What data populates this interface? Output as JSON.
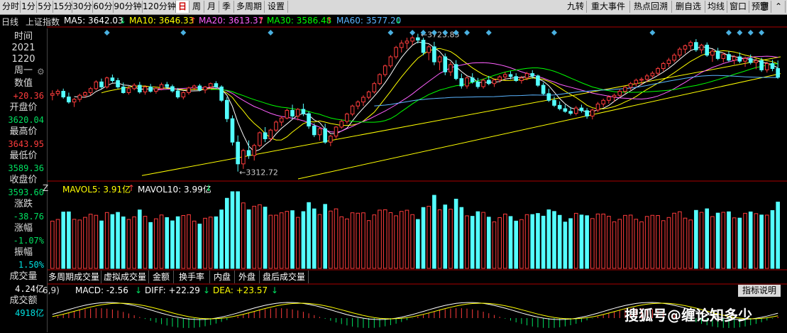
{
  "toolbar": {
    "left": [
      "分时",
      "1分",
      "5分",
      "15分",
      "30分",
      "60分",
      "90分钟",
      "120分钟",
      "日",
      "周",
      "月",
      "季",
      "多周期",
      "设置"
    ],
    "active_index": 8,
    "right": [
      "九转",
      "重大事件",
      "热点回溯",
      "删自选",
      "均线",
      "窗口",
      "预测"
    ]
  },
  "ma_legend": {
    "period": "日线",
    "name": "上证指数",
    "ma5": "MA5: 3642.03",
    "ma5_dir": "↓",
    "ma10": "MA10: 3646.33",
    "ma10_dir": "↑",
    "ma20": "MA20: 3613.37",
    "ma20_dir": "↑",
    "ma30": "MA30: 3586.48",
    "ma30_dir": "↑",
    "ma60": "MA60: 3577.20",
    "ma60_dir": "↓"
  },
  "left_panel": {
    "time_label": "时间",
    "year": "2021",
    "date": "1220",
    "weekday": "周一",
    "value_label": "数值",
    "value": "+20.36",
    "open_label": "开盘价",
    "open": "3620.04",
    "high_label": "最高价",
    "high": "3643.95",
    "low_label": "最低价",
    "low": "3589.36",
    "close_label": "收盘价",
    "close": "3593.60",
    "change_label": "涨跌",
    "change": "-38.76",
    "pct_label": "涨幅",
    "pct": "-1.07%",
    "amp_label": "振幅",
    "amp": "1.50%",
    "vol_label": "成交量",
    "vol": "4.24亿",
    "amt_label": "成交额",
    "amt": "4918亿"
  },
  "price_annotations": {
    "high": "3723.85",
    "low": "3312.72"
  },
  "vol_legend": {
    "cut": "Z",
    "mavol5": "MAVOL5: 3.91亿",
    "mavol5_dir": "↑",
    "mavol10": "MAVOL10: 3.99亿",
    "mavol10_dir": "↓"
  },
  "indicator_tabs": [
    "多周期成交量",
    "虚拟成交量",
    "金额",
    "换手率",
    "内盘",
    "外盘",
    "盘后成交量"
  ],
  "macd_legend": {
    "params": "6,9)",
    "macd": "MACD: -2.56",
    "macd_dir": "↓",
    "diff": "DIFF: +22.29",
    "diff_dir": "↓",
    "dea": "DEA: +23.57",
    "dea_dir": "↓"
  },
  "help_button": "指标说明",
  "watermark": "搜狐号@缠论知多少",
  "colors": {
    "up": "#ff3c3c",
    "down": "#54ffff",
    "ma5": "#ffffff",
    "ma10": "#ffff00",
    "ma20": "#ff60ff",
    "ma30": "#00ff00",
    "ma60": "#5ab4ff",
    "toolbar_bg": "#d9d9d9"
  },
  "chart_data": {
    "type": "candlestick",
    "title": "上证指数 日线",
    "ylim": [
      3290,
      3740
    ],
    "candles": [
      [
        3540,
        3555,
        3525,
        3545
      ],
      [
        3545,
        3558,
        3538,
        3552
      ],
      [
        3552,
        3560,
        3530,
        3535
      ],
      [
        3535,
        3548,
        3515,
        3520
      ],
      [
        3520,
        3532,
        3505,
        3528
      ],
      [
        3528,
        3545,
        3520,
        3540
      ],
      [
        3540,
        3552,
        3532,
        3548
      ],
      [
        3548,
        3565,
        3540,
        3560
      ],
      [
        3560,
        3585,
        3555,
        3580
      ],
      [
        3580,
        3590,
        3560,
        3565
      ],
      [
        3565,
        3596,
        3560,
        3592
      ],
      [
        3592,
        3602,
        3578,
        3584
      ],
      [
        3584,
        3592,
        3560,
        3565
      ],
      [
        3565,
        3578,
        3545,
        3548
      ],
      [
        3548,
        3568,
        3542,
        3560
      ],
      [
        3560,
        3576,
        3555,
        3570
      ],
      [
        3570,
        3580,
        3545,
        3550
      ],
      [
        3550,
        3570,
        3542,
        3565
      ],
      [
        3565,
        3574,
        3548,
        3552
      ],
      [
        3552,
        3566,
        3545,
        3560
      ],
      [
        3560,
        3578,
        3555,
        3572
      ],
      [
        3572,
        3580,
        3560,
        3566
      ],
      [
        3566,
        3572,
        3548,
        3553
      ],
      [
        3553,
        3562,
        3530,
        3535
      ],
      [
        3535,
        3552,
        3528,
        3548
      ],
      [
        3548,
        3566,
        3542,
        3562
      ],
      [
        3562,
        3572,
        3555,
        3568
      ],
      [
        3568,
        3574,
        3552,
        3556
      ],
      [
        3556,
        3568,
        3546,
        3565
      ],
      [
        3565,
        3578,
        3560,
        3575
      ],
      [
        3575,
        3582,
        3560,
        3565
      ],
      [
        3565,
        3570,
        3520,
        3525
      ],
      [
        3525,
        3535,
        3460,
        3470
      ],
      [
        3470,
        3480,
        3390,
        3400
      ],
      [
        3400,
        3420,
        3312,
        3335
      ],
      [
        3335,
        3380,
        3320,
        3375
      ],
      [
        3375,
        3405,
        3350,
        3360
      ],
      [
        3360,
        3395,
        3345,
        3390
      ],
      [
        3390,
        3432,
        3385,
        3428
      ],
      [
        3428,
        3445,
        3400,
        3410
      ],
      [
        3410,
        3440,
        3402,
        3436
      ],
      [
        3436,
        3465,
        3430,
        3460
      ],
      [
        3460,
        3478,
        3448,
        3472
      ],
      [
        3472,
        3500,
        3468,
        3495
      ],
      [
        3495,
        3512,
        3470,
        3478
      ],
      [
        3478,
        3502,
        3465,
        3498
      ],
      [
        3498,
        3515,
        3478,
        3485
      ],
      [
        3485,
        3492,
        3440,
        3448
      ],
      [
        3448,
        3456,
        3415,
        3422
      ],
      [
        3422,
        3445,
        3405,
        3440
      ],
      [
        3440,
        3455,
        3395,
        3400
      ],
      [
        3400,
        3422,
        3388,
        3418
      ],
      [
        3418,
        3448,
        3410,
        3445
      ],
      [
        3445,
        3468,
        3440,
        3462
      ],
      [
        3462,
        3488,
        3455,
        3484
      ],
      [
        3484,
        3512,
        3478,
        3508
      ],
      [
        3508,
        3525,
        3498,
        3520
      ],
      [
        3520,
        3540,
        3508,
        3534
      ],
      [
        3534,
        3554,
        3528,
        3550
      ],
      [
        3550,
        3580,
        3545,
        3575
      ],
      [
        3575,
        3606,
        3570,
        3602
      ],
      [
        3602,
        3632,
        3596,
        3628
      ],
      [
        3628,
        3660,
        3622,
        3655
      ],
      [
        3655,
        3688,
        3648,
        3683
      ],
      [
        3683,
        3705,
        3668,
        3696
      ],
      [
        3696,
        3712,
        3678,
        3702
      ],
      [
        3702,
        3718,
        3690,
        3712
      ],
      [
        3712,
        3724,
        3695,
        3705
      ],
      [
        3705,
        3712,
        3660,
        3668
      ],
      [
        3668,
        3690,
        3645,
        3685
      ],
      [
        3685,
        3700,
        3630,
        3640
      ],
      [
        3640,
        3660,
        3615,
        3655
      ],
      [
        3655,
        3665,
        3600,
        3610
      ],
      [
        3610,
        3640,
        3598,
        3632
      ],
      [
        3632,
        3645,
        3585,
        3590
      ],
      [
        3590,
        3605,
        3560,
        3568
      ],
      [
        3568,
        3598,
        3560,
        3592
      ],
      [
        3592,
        3606,
        3575,
        3580
      ],
      [
        3580,
        3592,
        3560,
        3566
      ],
      [
        3566,
        3590,
        3560,
        3585
      ],
      [
        3585,
        3598,
        3570,
        3575
      ],
      [
        3575,
        3590,
        3565,
        3586
      ],
      [
        3586,
        3600,
        3578,
        3595
      ],
      [
        3595,
        3610,
        3585,
        3602
      ],
      [
        3602,
        3612,
        3588,
        3596
      ],
      [
        3596,
        3606,
        3580,
        3584
      ],
      [
        3584,
        3598,
        3575,
        3592
      ],
      [
        3592,
        3610,
        3585,
        3605
      ],
      [
        3605,
        3615,
        3590,
        3598
      ],
      [
        3598,
        3602,
        3565,
        3570
      ],
      [
        3570,
        3578,
        3540,
        3545
      ],
      [
        3545,
        3560,
        3520,
        3525
      ],
      [
        3525,
        3536,
        3505,
        3510
      ],
      [
        3510,
        3522,
        3495,
        3500
      ],
      [
        3500,
        3512,
        3488,
        3492
      ],
      [
        3492,
        3505,
        3480,
        3486
      ],
      [
        3486,
        3508,
        3480,
        3502
      ],
      [
        3502,
        3512,
        3488,
        3494
      ],
      [
        3494,
        3502,
        3470,
        3478
      ],
      [
        3478,
        3500,
        3468,
        3496
      ],
      [
        3496,
        3520,
        3490,
        3514
      ],
      [
        3514,
        3530,
        3505,
        3525
      ],
      [
        3525,
        3540,
        3515,
        3535
      ],
      [
        3535,
        3545,
        3520,
        3540
      ],
      [
        3540,
        3558,
        3535,
        3552
      ],
      [
        3552,
        3568,
        3545,
        3564
      ],
      [
        3564,
        3580,
        3556,
        3575
      ],
      [
        3575,
        3590,
        3566,
        3585
      ],
      [
        3585,
        3594,
        3570,
        3588
      ],
      [
        3588,
        3604,
        3580,
        3598
      ],
      [
        3598,
        3612,
        3590,
        3606
      ],
      [
        3606,
        3625,
        3598,
        3620
      ],
      [
        3620,
        3640,
        3612,
        3635
      ],
      [
        3635,
        3652,
        3625,
        3645
      ],
      [
        3645,
        3666,
        3638,
        3660
      ],
      [
        3660,
        3684,
        3652,
        3678
      ],
      [
        3678,
        3692,
        3665,
        3688
      ],
      [
        3688,
        3704,
        3676,
        3698
      ],
      [
        3698,
        3708,
        3670,
        3676
      ],
      [
        3676,
        3694,
        3665,
        3690
      ],
      [
        3690,
        3698,
        3655,
        3660
      ],
      [
        3660,
        3678,
        3640,
        3672
      ],
      [
        3672,
        3682,
        3645,
        3650
      ],
      [
        3650,
        3668,
        3638,
        3662
      ],
      [
        3662,
        3672,
        3640,
        3645
      ],
      [
        3645,
        3660,
        3632,
        3655
      ],
      [
        3655,
        3668,
        3636,
        3642
      ],
      [
        3642,
        3656,
        3625,
        3650
      ],
      [
        3650,
        3662,
        3632,
        3638
      ],
      [
        3638,
        3650,
        3618,
        3644
      ],
      [
        3644,
        3652,
        3610,
        3616
      ],
      [
        3616,
        3640,
        3608,
        3635
      ],
      [
        3635,
        3646,
        3612,
        3620
      ],
      [
        3620,
        3644,
        3589,
        3594
      ]
    ]
  }
}
